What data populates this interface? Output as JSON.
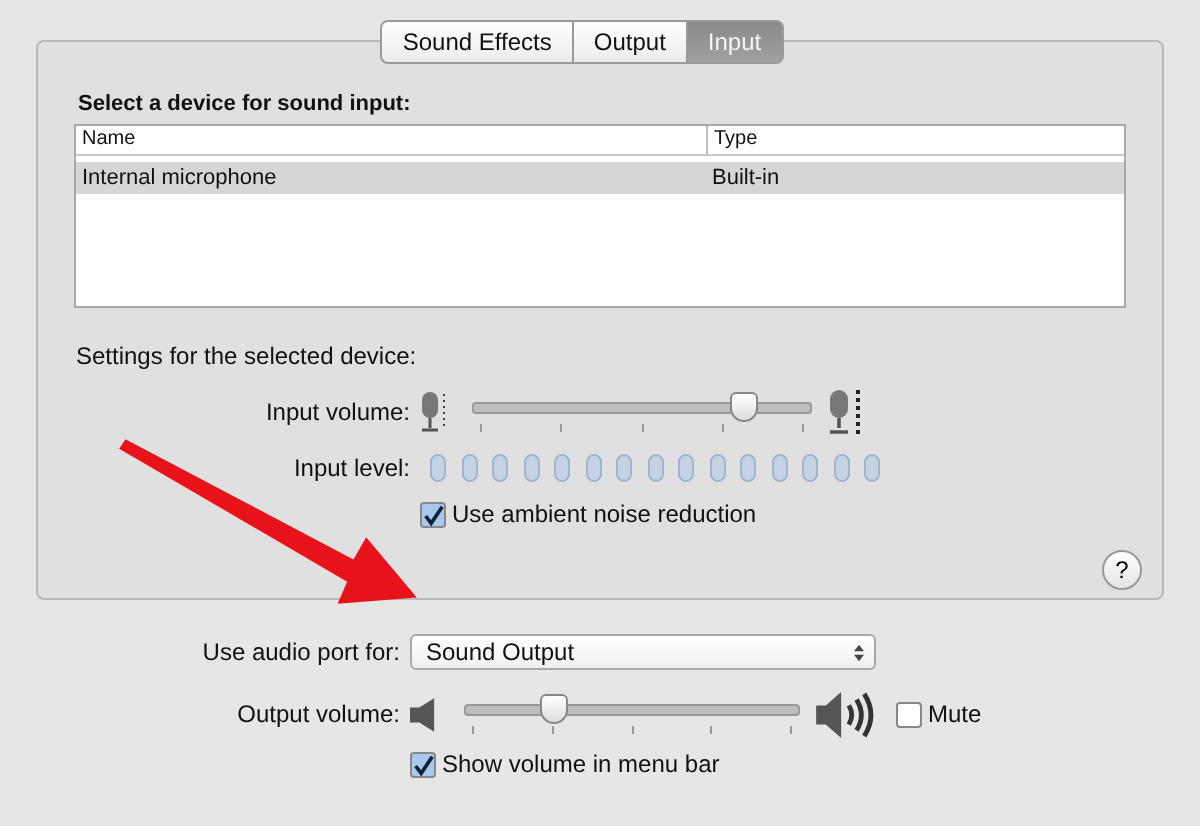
{
  "tabs": [
    {
      "label": "Sound Effects",
      "selected": false
    },
    {
      "label": "Output",
      "selected": false
    },
    {
      "label": "Input",
      "selected": true
    }
  ],
  "device_section": {
    "heading": "Select a device for sound input:",
    "columns": [
      "Name",
      "Type"
    ],
    "rows": [
      {
        "name": "Internal microphone",
        "type": "Built-in",
        "selected": true
      }
    ]
  },
  "settings": {
    "heading": "Settings for the selected device:",
    "input_volume": {
      "label": "Input volume:",
      "level": 0.8
    },
    "input_level": {
      "label": "Input level:"
    },
    "noise_reduction": {
      "label": "Use ambient noise reduction",
      "checked": true
    },
    "help": "?"
  },
  "audio_port": {
    "label": "Use audio port for:",
    "value": "Sound Output"
  },
  "output_volume": {
    "label": "Output volume:",
    "level": 0.27
  },
  "mute": {
    "label": "Mute",
    "checked": false
  },
  "show_volume": {
    "label": "Show volume in menu bar",
    "checked": true
  }
}
